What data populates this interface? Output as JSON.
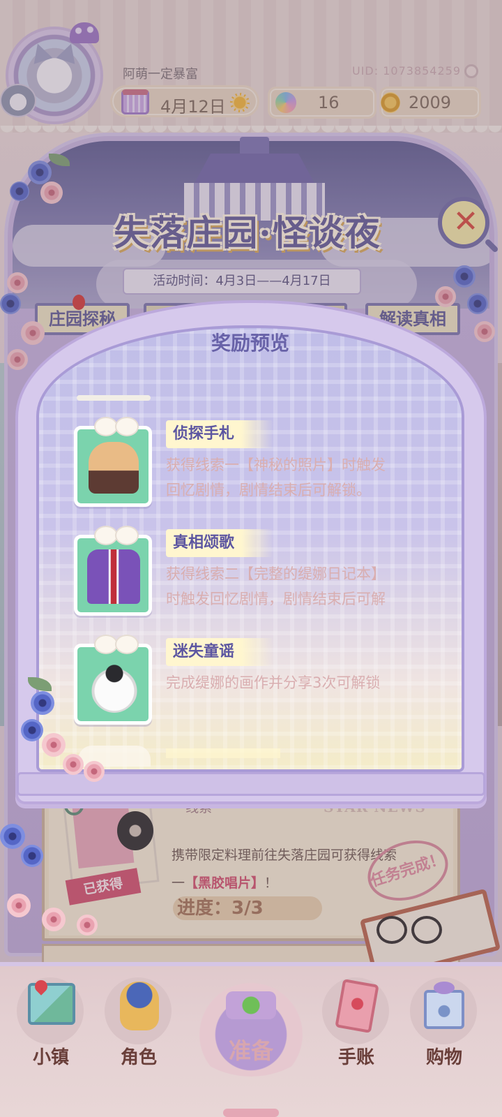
{
  "header": {
    "nickname": "阿萌一定暴富",
    "uid": "UID: 1073854259",
    "date": "4月12日",
    "gems": "16",
    "coins": "2009"
  },
  "event": {
    "title": "失落庄园·怪谈夜",
    "time": "活动时间：4月3日——4月17日",
    "tabs": {
      "manor": "庄园探秘",
      "truth": "解读真相"
    }
  },
  "modal": {
    "title": "奖励预览",
    "rewards": [
      {
        "name": "侦探手札",
        "desc_line1": "获得线索一【神秘的照片】时触发",
        "desc_line2": "回忆剧情，剧情结束后可解锁。",
        "icon": "detective-coat-icon"
      },
      {
        "name": "真相颂歌",
        "desc_line1": "获得线索二【完整的缇娜日记本】",
        "desc_line2": "时触发回忆剧情，剧情结束后可解",
        "icon": "purple-suit-icon"
      },
      {
        "name": "迷失童谣",
        "desc_line1": "完成缇娜的画作并分享3次可解锁",
        "desc_line2": "",
        "icon": "bear-costume-icon"
      }
    ]
  },
  "clue_card": {
    "title": "· 线索一",
    "news": "STAR NEWS",
    "line1": "携带限定料理前往失落庄园可获得线索",
    "line2_prefix": "一",
    "line2_highlight": "【黑胶唱片】",
    "line2_suffix": "！",
    "progress": "进度：3/3",
    "obtained": "已获得",
    "stamp": "任务完成！"
  },
  "nav": {
    "town": "小镇",
    "role": "角色",
    "prepare": "准备",
    "journal": "手账",
    "shop": "购物"
  },
  "colors": {
    "accent": "#6862a8",
    "highlight": "#d1506e",
    "gift_green": "#7bd3ad"
  }
}
